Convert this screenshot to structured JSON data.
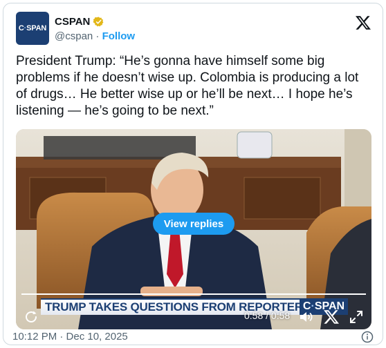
{
  "account": {
    "avatar_text_a": "C",
    "avatar_text_b": "·",
    "avatar_text_c": "SPAN",
    "name": "CSPAN",
    "handle": "@cspan",
    "separator": " · ",
    "follow_label": "Follow",
    "brand_color": "#1c3f73",
    "verified_color": "#e2b719"
  },
  "tweet": {
    "text": "President Trump: “He’s gonna have himself some big problems if he doesn’t wise up. Colombia is producing a lot of drugs… He better wise up or he’ll be next… I hope he’s listening — he’s going to be next.”"
  },
  "media": {
    "view_replies_label": "View replies",
    "chyron_text": "TRUMP TAKES QUESTIONS FROM REPORTERS",
    "chyron_logo_a": "C",
    "chyron_logo_b": "·",
    "chyron_logo_c": "SPAN",
    "time_display": "0:58 / 0:58",
    "progress": 1.0,
    "icons": [
      "replay-icon",
      "volume-icon",
      "x-logo-icon",
      "fullscreen-icon"
    ]
  },
  "footer": {
    "timestamp": "10:12 PM · Dec 10, 2025"
  },
  "colors": {
    "accent": "#1d9bf0",
    "text": "#0f1419",
    "muted": "#536471"
  }
}
